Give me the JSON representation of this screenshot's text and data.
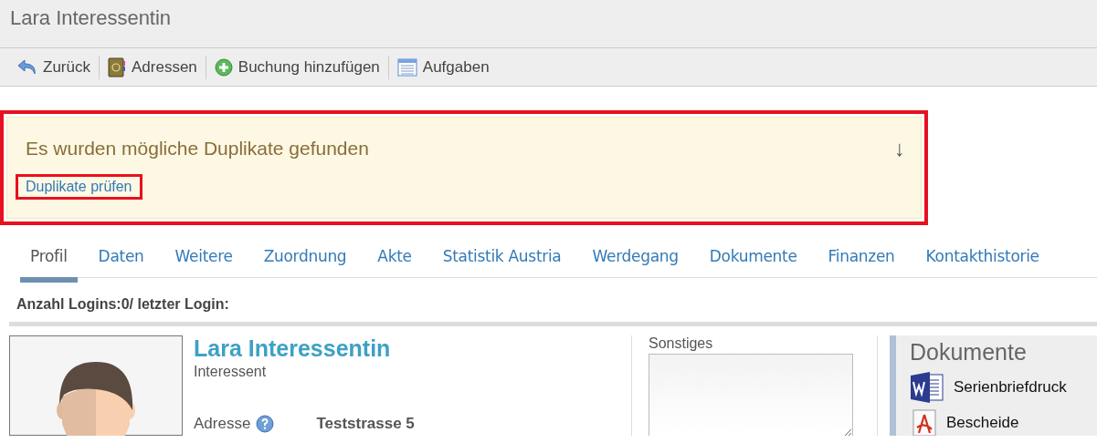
{
  "window": {
    "title": "Lara Interessentin"
  },
  "toolbar": [
    {
      "kind": "back",
      "label": "Zurück"
    },
    {
      "kind": "addressbook",
      "label": "Adressen"
    },
    {
      "kind": "add",
      "label": "Buchung hinzufügen"
    },
    {
      "kind": "tasks",
      "label": "Aufgaben"
    }
  ],
  "alert": {
    "message": "Es wurden mögliche Duplikate gefunden",
    "toggle": "↓",
    "link": "Duplikate prüfen",
    "highlighted": true,
    "link_highlighted": true
  },
  "tabs": [
    {
      "label": "Profil",
      "selected": true
    },
    {
      "label": "Daten",
      "selected": false
    },
    {
      "label": "Weitere",
      "selected": false
    },
    {
      "label": "Zuordnung",
      "selected": false
    },
    {
      "label": "Akte",
      "selected": false
    },
    {
      "label": "Statistik Austria",
      "selected": false
    },
    {
      "label": "Werdegang",
      "selected": false
    },
    {
      "label": "Dokumente",
      "selected": false
    },
    {
      "label": "Finanzen",
      "selected": false
    },
    {
      "label": "Kontakthistorie",
      "selected": false
    }
  ],
  "login_info": "Anzahl Logins:0/ letzter Login:",
  "profile": {
    "name": "Lara Interessentin",
    "role": "Interessent",
    "address_label": "Adresse",
    "address_line": "Teststrasse 5"
  },
  "notes": {
    "label": "Sonstiges"
  },
  "documents": {
    "title": "Dokumente",
    "items": [
      {
        "kind": "word",
        "label": "Serienbriefdruck"
      },
      {
        "kind": "pdf",
        "label": "Bescheide"
      }
    ]
  }
}
